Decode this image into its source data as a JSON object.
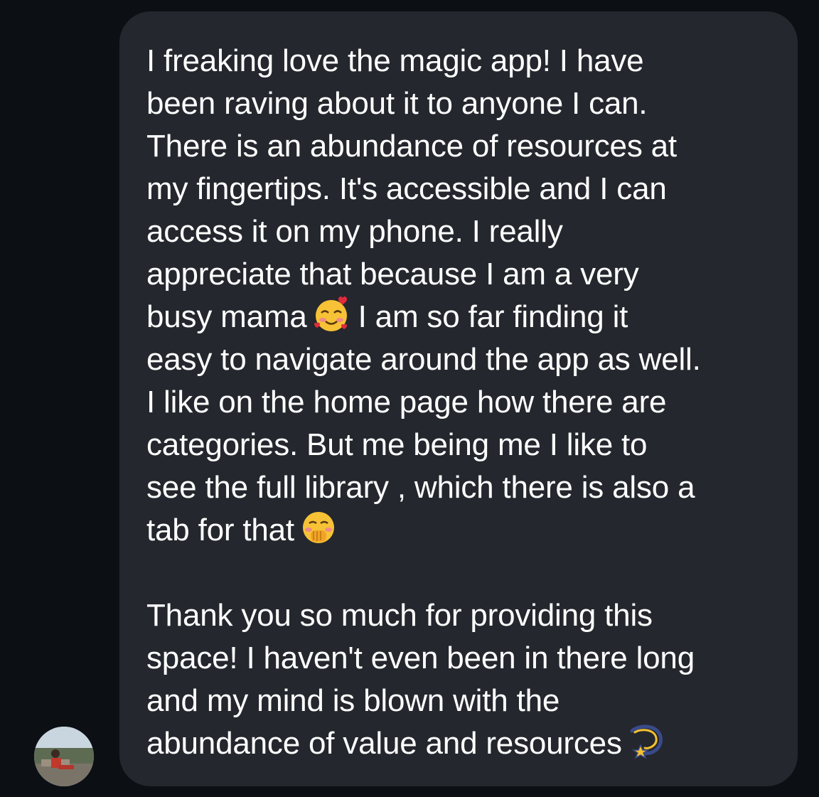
{
  "message": {
    "para1": [
      "I freaking love the magic app! I have",
      "been raving about it to anyone I can.",
      "There is an abundance of resources at",
      "my fingertips. It's accessible and I can",
      "access it on my phone. I really",
      "appreciate that because I am a very"
    ],
    "line7_before": "busy mama",
    "line7_after": "I am so far finding it",
    "para1_rest": [
      "easy to navigate around the app as well.",
      "I like on the home page how there are",
      "categories. But me being me I like to",
      "see the full library , which there is also a"
    ],
    "line12_before": "tab for that",
    "para2": [
      "Thank you so much for providing this",
      "space! I haven't even been in there long",
      "and my mind is blown with the"
    ],
    "last_line": "abundance of value and resources"
  },
  "icons": {
    "emoji_1": "smiling-face-with-hearts-icon",
    "emoji_2": "face-with-hand-over-mouth-icon",
    "emoji_3": "dizzy-icon",
    "avatar": "user-avatar"
  },
  "colors": {
    "background": "#0c0f14",
    "bubble": "#24272d",
    "text": "#ffffff"
  }
}
